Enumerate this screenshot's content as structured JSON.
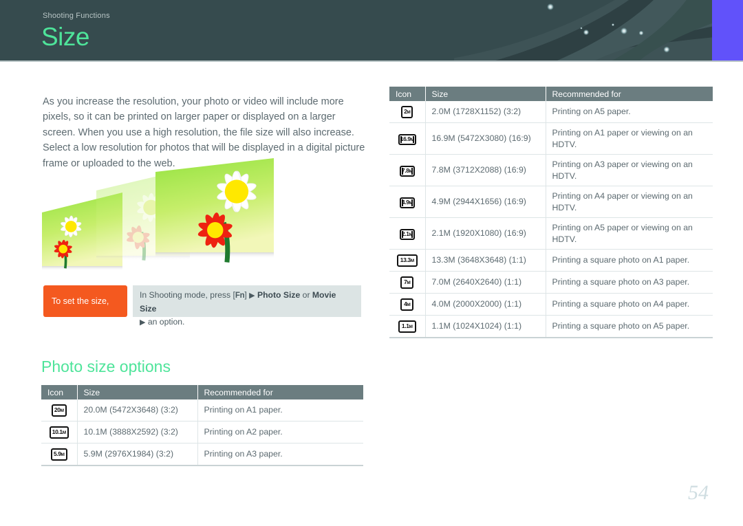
{
  "header": {
    "kicker": "Shooting Functions",
    "title": "Size",
    "accent_color": "#4ee49a",
    "background_color": "#364b4e",
    "block_color": "#6152fa"
  },
  "intro": {
    "paragraph": "As you increase the resolution, your photo or video will include more pixels, so it can be printed on larger paper or displayed on a larger screen. When you use a high resolution, the file size will also increase. Select a low resolution for photos that will be displayed in a digital picture frame or uploaded to the web."
  },
  "illustration": {
    "name": "three-photo-panels-with-daisies",
    "panel_count": 3
  },
  "callout": {
    "tag": "To set the size,",
    "tag_color": "#f4591f",
    "body_prefix": "In Shooting mode, press [",
    "key": "Fn",
    "body_mid": "] ",
    "arrow": "▶",
    "option_a": "Photo Size",
    "conjunction": " or ",
    "option_b": "Movie Size",
    "body_suffix": " an option."
  },
  "section": {
    "heading": "Photo size options"
  },
  "table": {
    "columns": [
      "Icon",
      "Size",
      "Recommended for"
    ],
    "left_rows": [
      {
        "icon": "20",
        "unit": "M",
        "ratio": "3:2",
        "size": "20.0M (5472X3648) (3:2)",
        "recommended": "Printing on A1 paper."
      },
      {
        "icon": "10.1",
        "unit": "M",
        "ratio": "3:2",
        "size": "10.1M (3888X2592) (3:2)",
        "recommended": "Printing on A2 paper."
      },
      {
        "icon": "5.9",
        "unit": "M",
        "ratio": "3:2",
        "size": "5.9M (2976X1984) (3:2)",
        "recommended": "Printing on A3 paper."
      }
    ],
    "right_rows": [
      {
        "icon": "2",
        "unit": "M",
        "ratio": "3:2",
        "size": "2.0M (1728X1152) (3:2)",
        "recommended": "Printing on A5 paper."
      },
      {
        "icon": "16.9",
        "unit": "M",
        "ratio": "16:9",
        "size": "16.9M (5472X3080) (16:9)",
        "recommended": "Printing on A1 paper or viewing on an HDTV."
      },
      {
        "icon": "7.8",
        "unit": "M",
        "ratio": "16:9",
        "size": "7.8M (3712X2088) (16:9)",
        "recommended": "Printing on A3 paper or viewing on an HDTV."
      },
      {
        "icon": "4.9",
        "unit": "M",
        "ratio": "16:9",
        "size": "4.9M (2944X1656) (16:9)",
        "recommended": "Printing on A4 paper or viewing on an HDTV."
      },
      {
        "icon": "2.1",
        "unit": "M",
        "ratio": "16:9",
        "size": "2.1M (1920X1080) (16:9)",
        "recommended": "Printing on A5 paper or viewing on an HDTV."
      },
      {
        "icon": "13.3",
        "unit": "M",
        "ratio": "1:1",
        "size": "13.3M (3648X3648) (1:1)",
        "recommended": "Printing a square photo on A1 paper."
      },
      {
        "icon": "7",
        "unit": "M",
        "ratio": "1:1",
        "size": "7.0M (2640X2640) (1:1)",
        "recommended": "Printing a square photo on A3 paper."
      },
      {
        "icon": "4",
        "unit": "M",
        "ratio": "1:1",
        "size": "4.0M (2000X2000) (1:1)",
        "recommended": "Printing a square photo on A4 paper."
      },
      {
        "icon": "1.1",
        "unit": "M",
        "ratio": "1:1",
        "size": "1.1M (1024X1024) (1:1)",
        "recommended": "Printing a square photo on A5 paper."
      }
    ]
  },
  "footer": {
    "page_number": "54"
  }
}
